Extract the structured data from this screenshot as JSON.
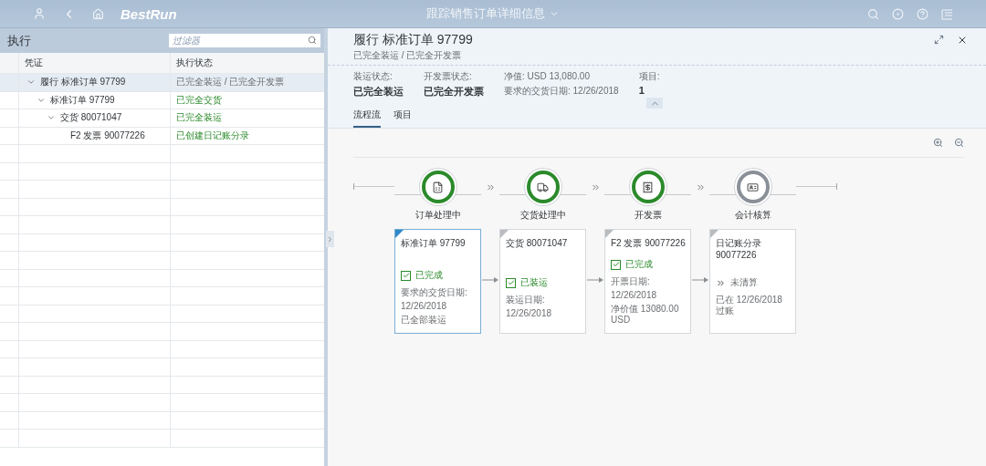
{
  "shell": {
    "logo": "BestRun",
    "title": "跟踪销售订单详细信息"
  },
  "left": {
    "title": "执行",
    "filter": {
      "placeholder": "过滤器"
    },
    "columns": [
      "凭证",
      "执行状态"
    ],
    "tree": [
      {
        "label": "履行 标准订单 97799",
        "status": "已完全装运 / 已完全开发票",
        "completed": false,
        "selected": true,
        "expanded": true,
        "children": [
          {
            "label": "标准订单 97799",
            "status": "已完全交货",
            "completed": true,
            "selected": false,
            "expanded": true,
            "children": [
              {
                "label": "交货 80071047",
                "status": "已完全装运",
                "completed": true,
                "selected": false,
                "expanded": true,
                "children": [
                  {
                    "label": "F2 发票 90077226",
                    "status": "已创建日记账分录",
                    "completed": true,
                    "selected": false
                  }
                ]
              }
            ]
          }
        ]
      }
    ]
  },
  "detail": {
    "title": "履行 标准订单 97799",
    "subtitle": "已完全装运 / 已完全开发票",
    "attributes": [
      {
        "kind": "stacked",
        "label": "装运状态:",
        "value": "已完全装运"
      },
      {
        "kind": "stacked",
        "label": "开发票状态:",
        "value": "已完全开发票"
      },
      {
        "kind": "inline",
        "lines": [
          {
            "label": "净值:",
            "value": "USD 13,080.00"
          },
          {
            "label": "要求的交货日期:",
            "value": "12/26/2018"
          }
        ]
      },
      {
        "kind": "stacked",
        "label": "项目:",
        "value": "1"
      }
    ],
    "tabs": [
      {
        "label": "流程流",
        "selected": true
      },
      {
        "label": "项目",
        "selected": false
      }
    ],
    "lanes": [
      {
        "label": "订单处理中",
        "completed": true
      },
      {
        "label": "交货处理中",
        "completed": true
      },
      {
        "label": "开发票",
        "completed": true
      },
      {
        "label": "会计核算",
        "completed": false
      }
    ],
    "cards": [
      {
        "title": "标准订单 97799",
        "selected": true,
        "status": {
          "kind": "checked",
          "text": "已完成"
        },
        "details": [
          "要求的交货日期:",
          "12/26/2018",
          "已全部装运"
        ]
      },
      {
        "title": "交货 80071047",
        "selected": false,
        "status": {
          "kind": "checked",
          "text": "已装运"
        },
        "details": [
          "装运日期:",
          "12/26/2018"
        ]
      },
      {
        "title": "F2 发票 90077226",
        "selected": false,
        "status": {
          "kind": "checked",
          "text": "已完成"
        },
        "details": [
          "开票日期:",
          "12/26/2018",
          "净价值 13080.00 USD"
        ]
      },
      {
        "title": "日记账分录 90077226",
        "selected": false,
        "status": {
          "kind": "pending",
          "text": "未清算"
        },
        "details": [
          "已在 12/26/2018 过账"
        ]
      }
    ]
  }
}
